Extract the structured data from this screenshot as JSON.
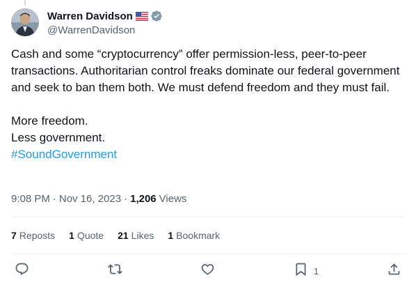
{
  "author": {
    "display_name": "Warren Davidson",
    "handle": "@WarrenDavidson"
  },
  "tweet": {
    "body": "Cash and some “cryptocurrency” offer permission-less, peer-to-peer transactions. Authoritarian control freaks dominate our federal government and seek to ban them both. We must defend freedom and they must fail.\n\nMore freedom.\nLess government.\n",
    "hashtag": "#SoundGovernment"
  },
  "meta": {
    "time": "9:08 PM",
    "date": "Nov 16, 2023",
    "views_count": "1,206",
    "views_label": "Views"
  },
  "stats": {
    "reposts_count": "7",
    "reposts_label": "Reposts",
    "quotes_count": "1",
    "quotes_label": "Quote",
    "likes_count": "21",
    "likes_label": "Likes",
    "bookmarks_count": "1",
    "bookmarks_label": "Bookmark"
  },
  "actions": {
    "bookmark_count": "1"
  },
  "icons": {
    "verified": "verified-badge-icon",
    "flag": "us-flag-icon",
    "reply": "reply-icon",
    "repost": "repost-icon",
    "like": "like-icon",
    "bookmark": "bookmark-icon",
    "share": "share-icon"
  },
  "colors": {
    "text": "#0f1419",
    "secondary": "#536471",
    "link": "#1d9bf0",
    "verified": "#829aab",
    "divider": "#eff3f4"
  }
}
